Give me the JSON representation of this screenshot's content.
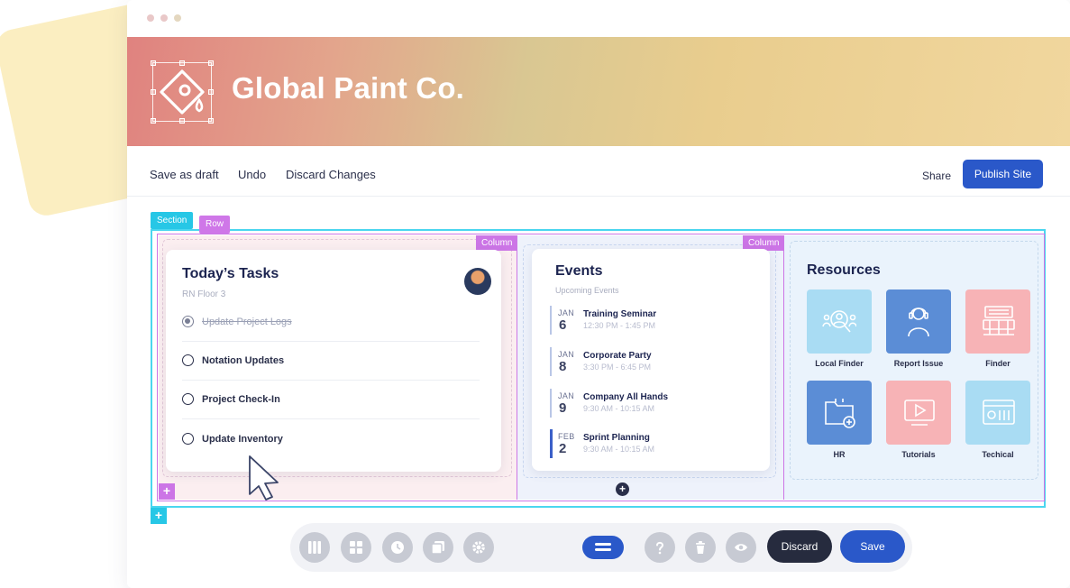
{
  "brand": {
    "name": "Global Paint Co.",
    "logo_icon": "paint-bucket-icon"
  },
  "toolbar": {
    "save_draft": "Save as draft",
    "undo": "Undo",
    "discard_changes": "Discard Changes",
    "share": "Share",
    "publish": "Publish Site"
  },
  "builder": {
    "section_tag": "Section",
    "row_tag": "Row",
    "column_tag": "Column",
    "add_symbol": "+"
  },
  "tasks": {
    "title": "Today’s Tasks",
    "subtitle": "RN Floor 3",
    "items": [
      {
        "label": "Update Project Logs",
        "done": true
      },
      {
        "label": "Notation Updates",
        "done": false
      },
      {
        "label": "Project Check-In",
        "done": false
      },
      {
        "label": "Update Inventory",
        "done": false
      }
    ]
  },
  "events": {
    "title": "Events",
    "subtitle": "Upcoming Events",
    "items": [
      {
        "month": "JAN",
        "day": "6",
        "name": "Training Seminar",
        "time": "12:30 PM - 1:45 PM"
      },
      {
        "month": "JAN",
        "day": "8",
        "name": "Corporate Party",
        "time": "3:30 PM - 6:45 PM"
      },
      {
        "month": "JAN",
        "day": "9",
        "name": "Company All Hands",
        "time": "9:30 AM - 10:15 AM"
      },
      {
        "month": "FEB",
        "day": "2",
        "name": "Sprint Planning",
        "time": "9:30 AM - 10:15 AM"
      }
    ]
  },
  "resources": {
    "title": "Resources",
    "items": [
      {
        "label": "Local Finder",
        "icon": "people-search-icon",
        "color": "#a9dcf3"
      },
      {
        "label": "Report Issue",
        "icon": "support-agent-icon",
        "color": "#5b8dd6"
      },
      {
        "label": "Finder",
        "icon": "building-icon",
        "color": "#f7b3b6"
      },
      {
        "label": "HR",
        "icon": "folder-add-icon",
        "color": "#5b8dd6"
      },
      {
        "label": "Tutorials",
        "icon": "video-play-icon",
        "color": "#f7b3b6"
      },
      {
        "label": "Techical",
        "icon": "control-panel-icon",
        "color": "#a9dcf3"
      }
    ]
  },
  "dock": {
    "discard": "Discard",
    "save": "Save"
  },
  "colors": {
    "accent": "#2a58c9",
    "section": "#27c7e6",
    "row": "#cf77e8"
  }
}
